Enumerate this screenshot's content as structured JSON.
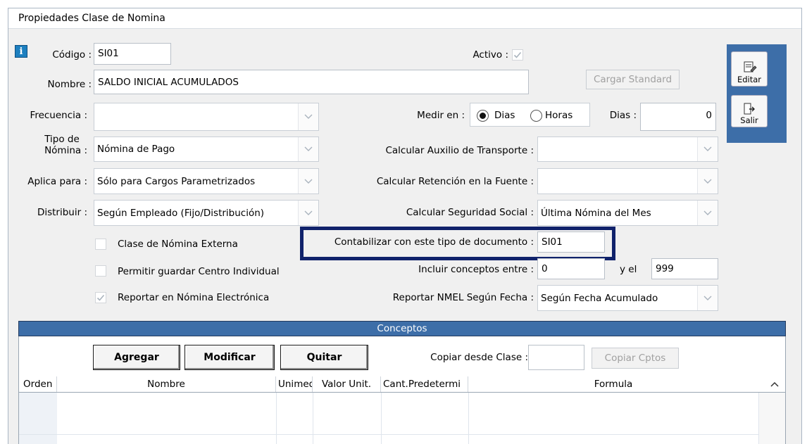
{
  "window": {
    "title": "Propiedades Clase de Nomina"
  },
  "form": {
    "codigo_label": "Código :",
    "codigo_value": "SI01",
    "activo_label": "Activo :",
    "nombre_label": "Nombre :",
    "nombre_value": "SALDO INICIAL ACUMULADOS",
    "cargar_standard_label": "Cargar Standard",
    "frecuencia_label": "Frecuencia :",
    "frecuencia_value": "",
    "medir_en_label": "Medir en :",
    "radio_dias_label": "Dias",
    "radio_horas_label": "Horas",
    "dias_label": "Dias :",
    "dias_value": "0",
    "tipo_nomina_label_1": "Tipo de",
    "tipo_nomina_label_2": "Nómina :",
    "tipo_nomina_value": "Nómina de Pago",
    "aux_transporte_label": "Calcular Auxilio de Transporte :",
    "aux_transporte_value": "",
    "aplica_para_label": "Aplica para :",
    "aplica_para_value": "Sólo para Cargos Parametrizados",
    "retencion_label": "Calcular Retención en la Fuente :",
    "retencion_value": "",
    "distribuir_label": "Distribuir :",
    "distribuir_value": "Según Empleado (Fijo/Distribución)",
    "seguridad_social_label": "Calcular Seguridad Social :",
    "seguridad_social_value": "Última Nómina del Mes",
    "clase_externa_label": "Clase de Nómina Externa",
    "contabilizar_label": "Contabilizar con este tipo de documento :",
    "contabilizar_value": "SI01",
    "centro_individual_label": "Permitir guardar Centro Individual",
    "incluir_conceptos_label": "Incluir conceptos entre :",
    "incluir_desde": "0",
    "y_el_label": "y el",
    "incluir_hasta": "999",
    "reportar_nomina_label": "Reportar en Nómina Electrónica",
    "reportar_nmel_label": "Reportar NMEL Según Fecha :",
    "reportar_nmel_value": "Según Fecha Acumulado",
    "clase_externa_checked": false,
    "centro_individual_checked": false,
    "reportar_nomina_checked": true,
    "activo_checked": true,
    "medir_en_selected": "Dias"
  },
  "toolbar": {
    "editar_label": "Editar",
    "salir_label": "Salir"
  },
  "conceptos": {
    "header": "Conceptos",
    "agregar_label": "Agregar",
    "modificar_label": "Modificar",
    "quitar_label": "Quitar",
    "copiar_desde_label": "Copiar desde Clase :",
    "copiar_desde_value": "",
    "copiar_cptos_label": "Copiar Cptos",
    "columns": [
      "Orden",
      "Nombre",
      "Unimed",
      "Valor Unit.",
      "Cant.Predetermi",
      "Formula"
    ]
  },
  "colors": {
    "accent": "#3d6ea8",
    "highlight_border": "#10226b",
    "info_icon": "#1d7fbf"
  }
}
